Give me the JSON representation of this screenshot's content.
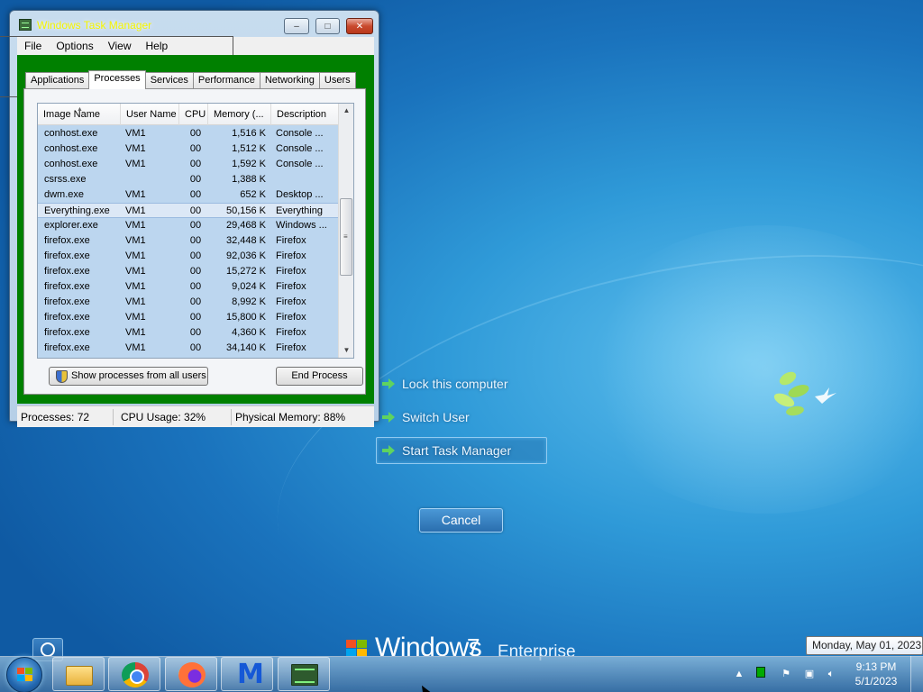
{
  "window": {
    "title": "Windows Task Manager",
    "controls": {
      "minimize": "–",
      "maximize": "□",
      "close": "✕"
    }
  },
  "menubar": [
    "File",
    "Options",
    "View",
    "Help"
  ],
  "tabs": [
    "Applications",
    "Processes",
    "Services",
    "Performance",
    "Networking",
    "Users"
  ],
  "active_tab": "Processes",
  "processes": {
    "columns": [
      "Image Name",
      "User Name",
      "CPU",
      "Memory (...",
      "Description"
    ],
    "rows": [
      {
        "name": "conhost.exe",
        "user": "VM1",
        "cpu": "00",
        "mem": "1,516 K",
        "desc": "Console ..."
      },
      {
        "name": "conhost.exe",
        "user": "VM1",
        "cpu": "00",
        "mem": "1,512 K",
        "desc": "Console ..."
      },
      {
        "name": "conhost.exe",
        "user": "VM1",
        "cpu": "00",
        "mem": "1,592 K",
        "desc": "Console ..."
      },
      {
        "name": "csrss.exe",
        "user": "",
        "cpu": "00",
        "mem": "1,388 K",
        "desc": ""
      },
      {
        "name": "dwm.exe",
        "user": "VM1",
        "cpu": "00",
        "mem": "652 K",
        "desc": "Desktop ..."
      },
      {
        "name": "Everything.exe",
        "user": "VM1",
        "cpu": "00",
        "mem": "50,156 K",
        "desc": "Everything"
      },
      {
        "name": "explorer.exe",
        "user": "VM1",
        "cpu": "00",
        "mem": "29,468 K",
        "desc": "Windows ..."
      },
      {
        "name": "firefox.exe",
        "user": "VM1",
        "cpu": "00",
        "mem": "32,448 K",
        "desc": "Firefox"
      },
      {
        "name": "firefox.exe",
        "user": "VM1",
        "cpu": "00",
        "mem": "92,036 K",
        "desc": "Firefox"
      },
      {
        "name": "firefox.exe",
        "user": "VM1",
        "cpu": "00",
        "mem": "15,272 K",
        "desc": "Firefox"
      },
      {
        "name": "firefox.exe",
        "user": "VM1",
        "cpu": "00",
        "mem": "9,024 K",
        "desc": "Firefox"
      },
      {
        "name": "firefox.exe",
        "user": "VM1",
        "cpu": "00",
        "mem": "8,992 K",
        "desc": "Firefox"
      },
      {
        "name": "firefox.exe",
        "user": "VM1",
        "cpu": "00",
        "mem": "15,800 K",
        "desc": "Firefox"
      },
      {
        "name": "firefox.exe",
        "user": "VM1",
        "cpu": "00",
        "mem": "4,360 K",
        "desc": "Firefox"
      },
      {
        "name": "firefox.exe",
        "user": "VM1",
        "cpu": "00",
        "mem": "34,140 K",
        "desc": "Firefox"
      }
    ],
    "highlighted_row": "Everything.exe"
  },
  "buttons": {
    "show_all": "Show processes from all users",
    "end_process": "End Process",
    "cancel": "Cancel"
  },
  "status": {
    "processes": "Processes: 72",
    "cpu": "CPU Usage: 32%",
    "memory": "Physical Memory: 88%"
  },
  "security_options": [
    "Lock this computer",
    "Switch User",
    "Start Task Manager"
  ],
  "selected_option": "Start Task Manager",
  "branding": {
    "name": "Windows",
    "version": "7",
    "edition": "Enterprise"
  },
  "taskbar": {
    "pinned": [
      "folder-icon",
      "chrome-icon",
      "firefox-icon",
      "malwarebytes-icon",
      "task-manager-icon"
    ],
    "clock_time": "9:13 PM",
    "clock_date": "5/1/2023",
    "tooltip": "Monday, May 01, 2023"
  },
  "colors": {
    "tab_frame": "#008000",
    "title_text": "#f5f500",
    "list_background": "#bcd6ef",
    "wallpaper": "#2f9ad8"
  }
}
